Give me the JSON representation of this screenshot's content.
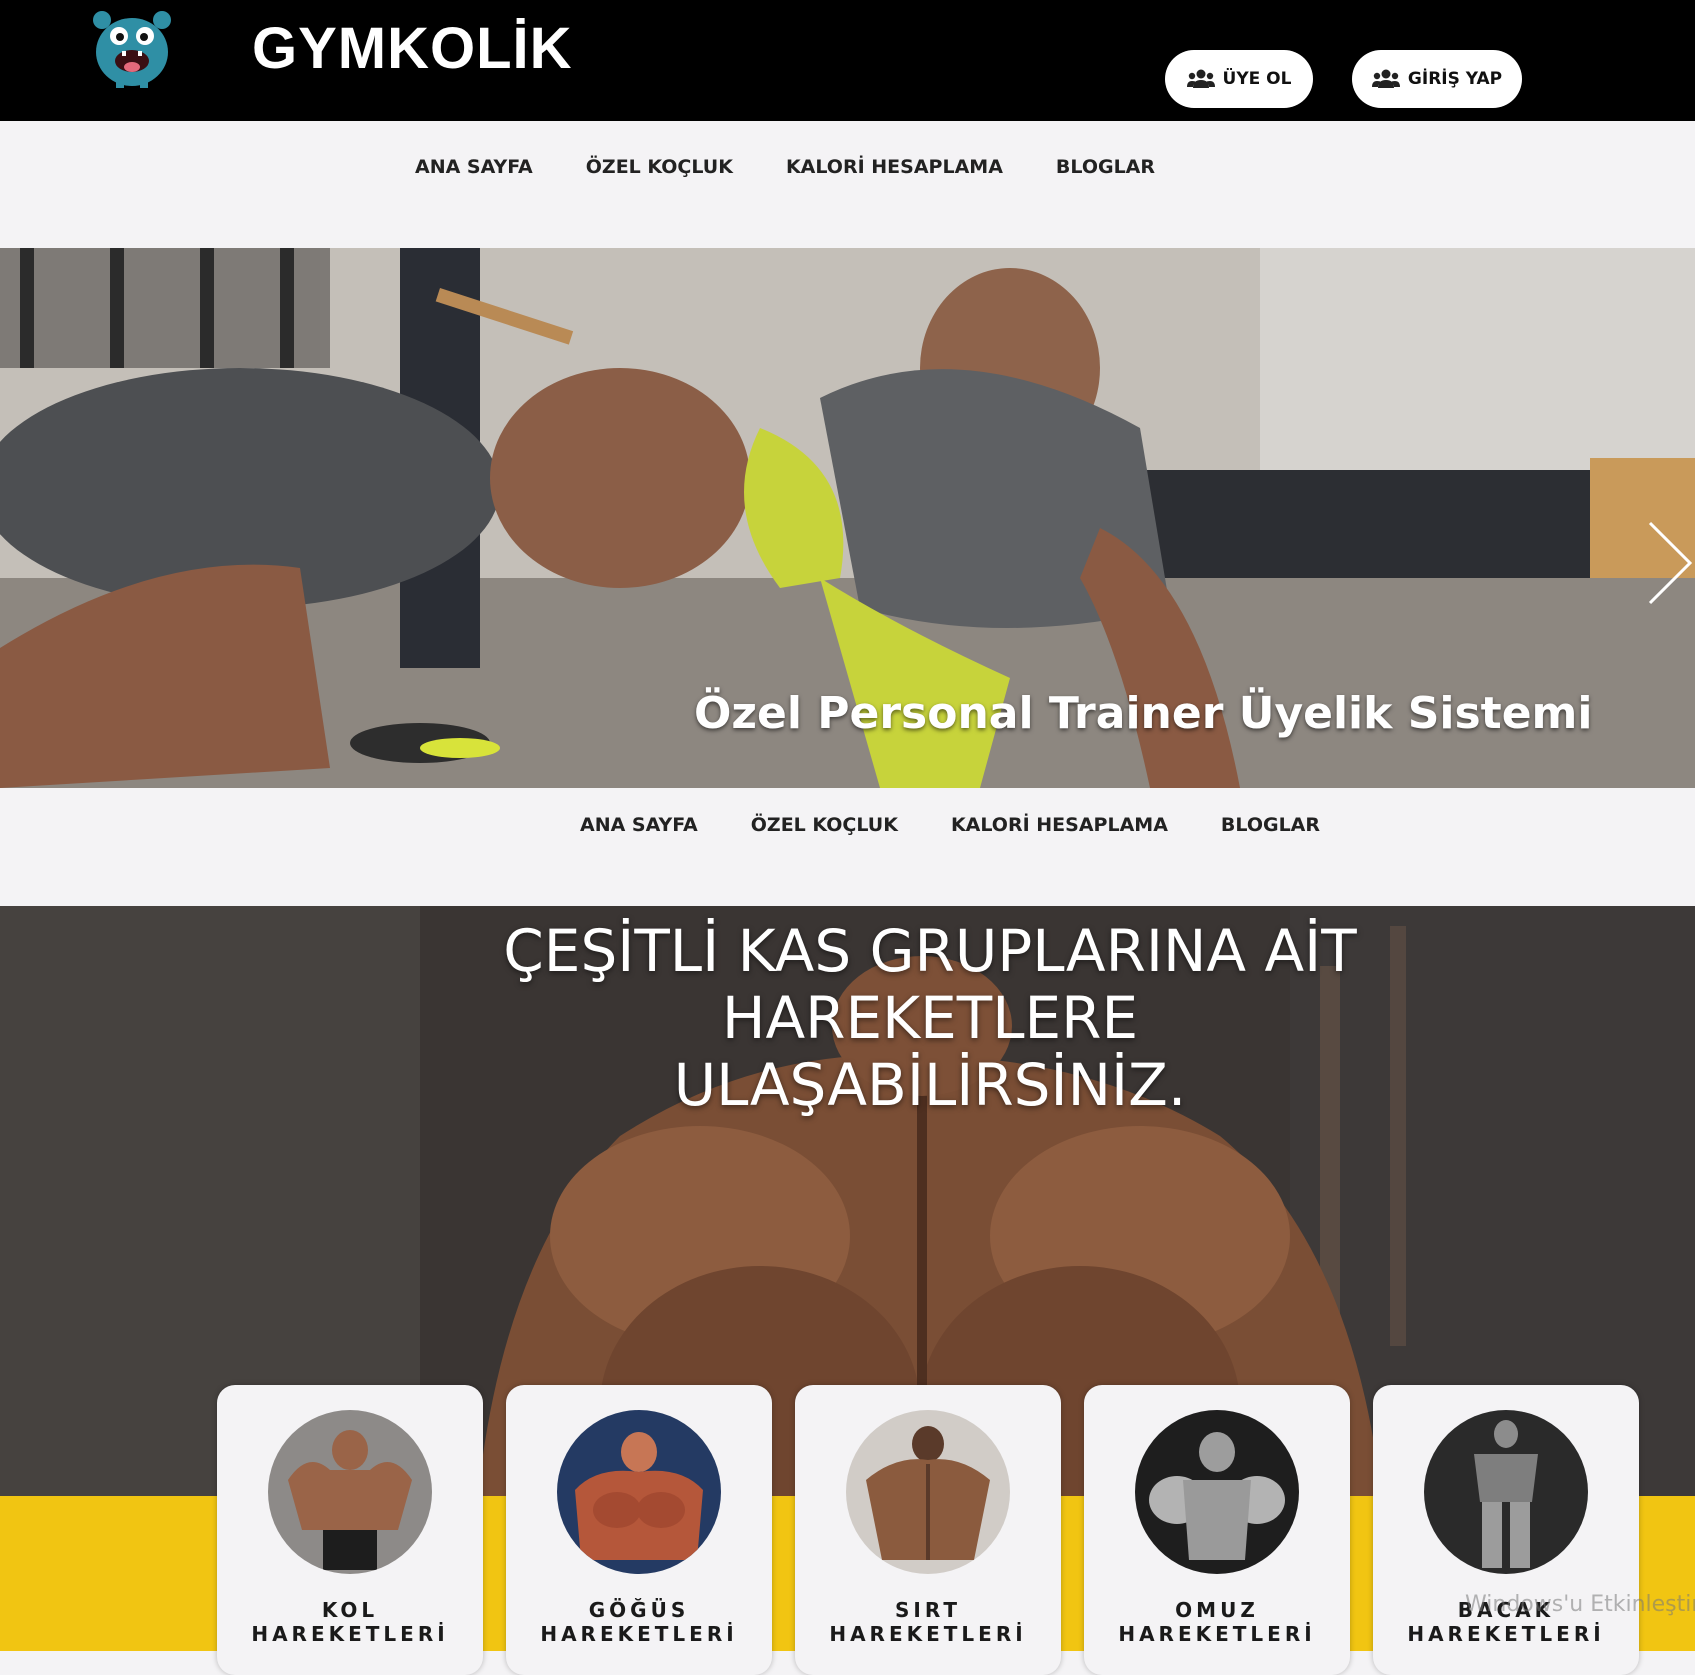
{
  "header": {
    "brand": "GYMKOLİK",
    "signup_label": "ÜYE OL",
    "login_label": "GİRİŞ YAP"
  },
  "nav_top": {
    "items": [
      "ANA SAYFA",
      "ÖZEL KOÇLUK",
      "KALORİ HESAPLAMA",
      "BLOGLAR"
    ]
  },
  "hero": {
    "caption": "Özel Personal Trainer Üyelik Sistemi"
  },
  "nav_bottom": {
    "items": [
      "ANA SAYFA",
      "ÖZEL KOÇLUK",
      "KALORİ HESAPLAMA",
      "BLOGLAR"
    ]
  },
  "muscle_section": {
    "title_lines": [
      "ÇEŞİTLİ KAS GRUPLARINA AİT",
      "HAREKETLERE",
      "ULAŞABİLİRSİNİZ."
    ],
    "cards": [
      {
        "line1": "KOL",
        "line2": "HAREKETLERİ"
      },
      {
        "line1": "GÖĞÜS",
        "line2": "HAREKETLERİ"
      },
      {
        "line1": "SIRT",
        "line2": "HAREKETLERİ"
      },
      {
        "line1": "OMUZ",
        "line2": "HAREKETLERİ"
      },
      {
        "line1": "BACAK",
        "line2": "HAREKETLERİ"
      }
    ]
  },
  "overlay": {
    "watermark": "Windows'u Etkinleştir"
  },
  "colors": {
    "topbar": "#000000",
    "accent_yellow": "#f1c512",
    "page_bg": "#f4f3f5"
  }
}
